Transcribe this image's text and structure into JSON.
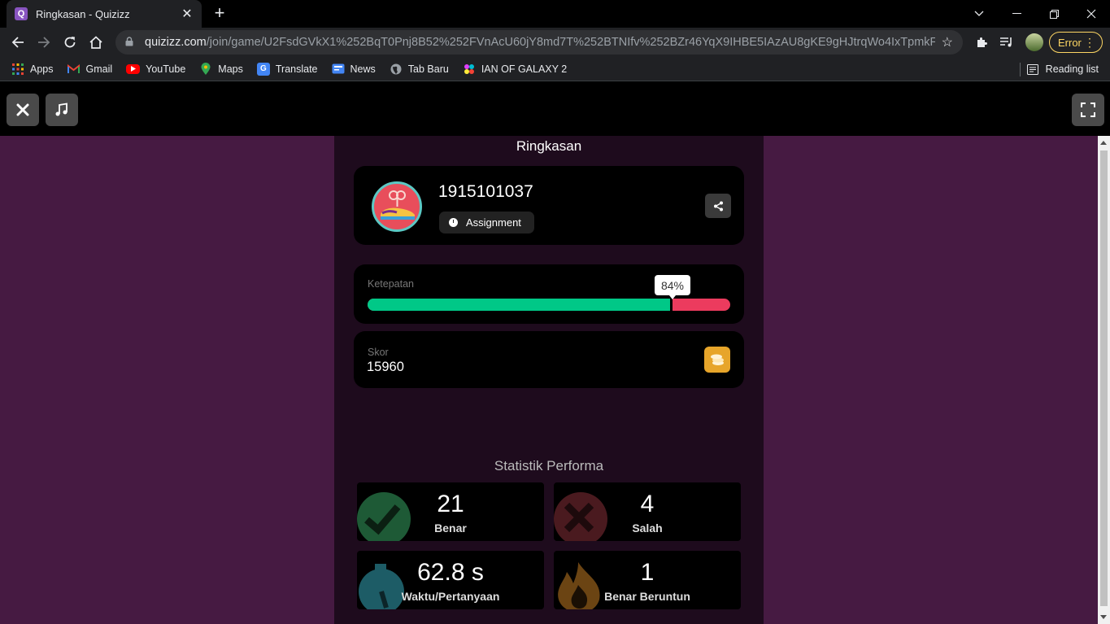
{
  "browser": {
    "tab_title": "Ringkasan - Quizizz",
    "tab_favicon_letter": "Q",
    "url_host": "quizizz.com",
    "url_path": "/join/game/U2FsdGVkX1%252BqT0Pnj8B52%252FVnAcU60jY8md7T%252BTNIfv%252BZr46YqX9IHBE5IAzAU8gKE9gHJtrqWo4IxTpmkFU%252Bw...",
    "error_label": "Error",
    "bookmarks": [
      {
        "label": "Apps",
        "icon": "apps-grid-icon",
        "color": "#ea4335"
      },
      {
        "label": "Gmail",
        "icon": "gmail-icon",
        "color": "#ea4335"
      },
      {
        "label": "YouTube",
        "icon": "youtube-icon",
        "color": "#ff0000"
      },
      {
        "label": "Maps",
        "icon": "maps-pin-icon",
        "color": "#34a853"
      },
      {
        "label": "Translate",
        "icon": "translate-icon",
        "color": "#4285f4"
      },
      {
        "label": "News",
        "icon": "news-icon",
        "color": "#4285f4"
      },
      {
        "label": "Tab Baru",
        "icon": "globe-icon",
        "color": "#9aa0a6"
      },
      {
        "label": "IAN OF GALAXY 2",
        "icon": "galaxy-icon",
        "color": "#e040fb"
      }
    ],
    "reading_list_label": "Reading list"
  },
  "page": {
    "title": "Ringkasan",
    "player_name": "1915101037",
    "mode_label": "Assignment",
    "accuracy_label": "Ketepatan",
    "accuracy_text": "84%",
    "accuracy_fraction": 0.84,
    "score_label": "Skor",
    "score_value": "15960",
    "stats_title": "Statistik Performa",
    "stats": {
      "correct_value": "21",
      "correct_label": "Benar",
      "wrong_value": "4",
      "wrong_label": "Salah",
      "time_value": "62.8 s",
      "time_label": "Waktu/Pertanyaan",
      "streak_value": "1",
      "streak_label": "Benar Beruntun"
    }
  },
  "colors": {
    "page_bg": "#461a42",
    "panel_bg": "#1e0b1d",
    "correct_green": "#00c887",
    "wrong_red": "#ec3b5e",
    "coin_gold": "#e7a52a"
  }
}
